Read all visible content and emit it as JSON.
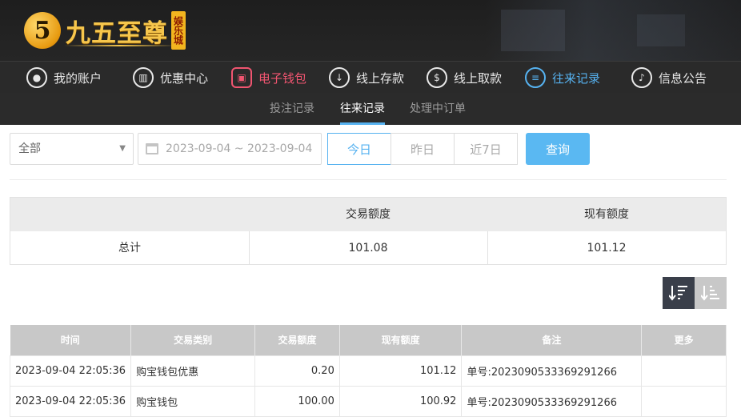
{
  "header": {
    "logo_mark": "5",
    "logo_text": "九五至尊",
    "logo_tag": "娱乐城"
  },
  "nav": {
    "items": [
      {
        "label": "我的账户",
        "icon": "user-icon",
        "state": "normal"
      },
      {
        "label": "优惠中心",
        "icon": "gift-icon",
        "state": "normal"
      },
      {
        "label": "电子钱包",
        "icon": "wallet-icon",
        "state": "highlight-red"
      },
      {
        "label": "线上存款",
        "icon": "deposit-icon",
        "state": "normal"
      },
      {
        "label": "线上取款",
        "icon": "withdraw-icon",
        "state": "normal"
      },
      {
        "label": "往来记录",
        "icon": "record-icon",
        "state": "active"
      },
      {
        "label": "信息公告",
        "icon": "bell-icon",
        "state": "normal"
      }
    ]
  },
  "subnav": {
    "items": [
      {
        "label": "投注记录",
        "active": false
      },
      {
        "label": "往来记录",
        "active": true
      },
      {
        "label": "处理中订单",
        "active": false
      }
    ]
  },
  "filters": {
    "type_select": "全部",
    "date_range": "2023-09-04 ~ 2023-09-04",
    "quick": [
      {
        "label": "今日",
        "active": true
      },
      {
        "label": "昨日",
        "active": false
      },
      {
        "label": "近7日",
        "active": false
      }
    ],
    "query_label": "查询"
  },
  "summary": {
    "headers": [
      "",
      "交易额度",
      "现有额度"
    ],
    "row": {
      "label": "总计",
      "transaction": "101.08",
      "balance": "101.12"
    }
  },
  "records": {
    "columns": [
      "时间",
      "交易类别",
      "交易额度",
      "现有额度",
      "备注",
      "更多"
    ],
    "rows": [
      {
        "time": "2023-09-04 22:05:36",
        "type": "购宝钱包优惠",
        "amount": "0.20",
        "balance": "101.12",
        "note": "单号:2023090533369291266",
        "more": ""
      },
      {
        "time": "2023-09-04 22:05:36",
        "type": "购宝钱包",
        "amount": "100.00",
        "balance": "100.92",
        "note": "单号:2023090533369291266",
        "more": ""
      }
    ]
  },
  "colors": {
    "accent_blue": "#56b2f0",
    "accent_red": "#f05570",
    "header_bg": "#1e1e1e",
    "logo_gold": "#f6c64c"
  }
}
